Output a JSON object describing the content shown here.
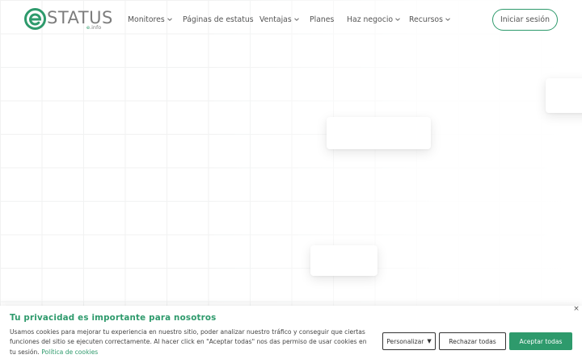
{
  "brand": {
    "name": "STATUS",
    "sub_dot": "e",
    "sub_text": ".info",
    "color": "#2e9a6c",
    "text_color": "#7d7d7d"
  },
  "nav": {
    "items": [
      {
        "label": "Monitores",
        "dropdown": true
      },
      {
        "label": "Páginas de estatus",
        "dropdown": false
      },
      {
        "label": "Ventajas",
        "dropdown": true
      },
      {
        "label": "Planes",
        "dropdown": false
      },
      {
        "label": "Haz negocio",
        "dropdown": true
      },
      {
        "label": "Recursos",
        "dropdown": true
      }
    ],
    "login_label": "Iniciar sesión"
  },
  "cookie": {
    "title": "Tu privacidad es importante para nosotros",
    "body": "Usamos cookies para mejorar tu experiencia en nuestro sitio, poder analizar nuestro tráfico y conseguir que ciertas funciones del sitio se ejecuten correctamente. Al hacer click en \"Aceptar todas\" nos das permiso de usar cookies en tu sesión.",
    "policy_link": "Política de cookies",
    "close_icon": "×",
    "customize_label": "Personalizar",
    "reject_label": "Rechazar todas",
    "accept_label": "Aceptar todas"
  },
  "icons": {
    "logo": "estatus-logo-icon",
    "chevron": "chevron-down-icon",
    "close": "close-icon",
    "caret": "caret-down-icon"
  }
}
